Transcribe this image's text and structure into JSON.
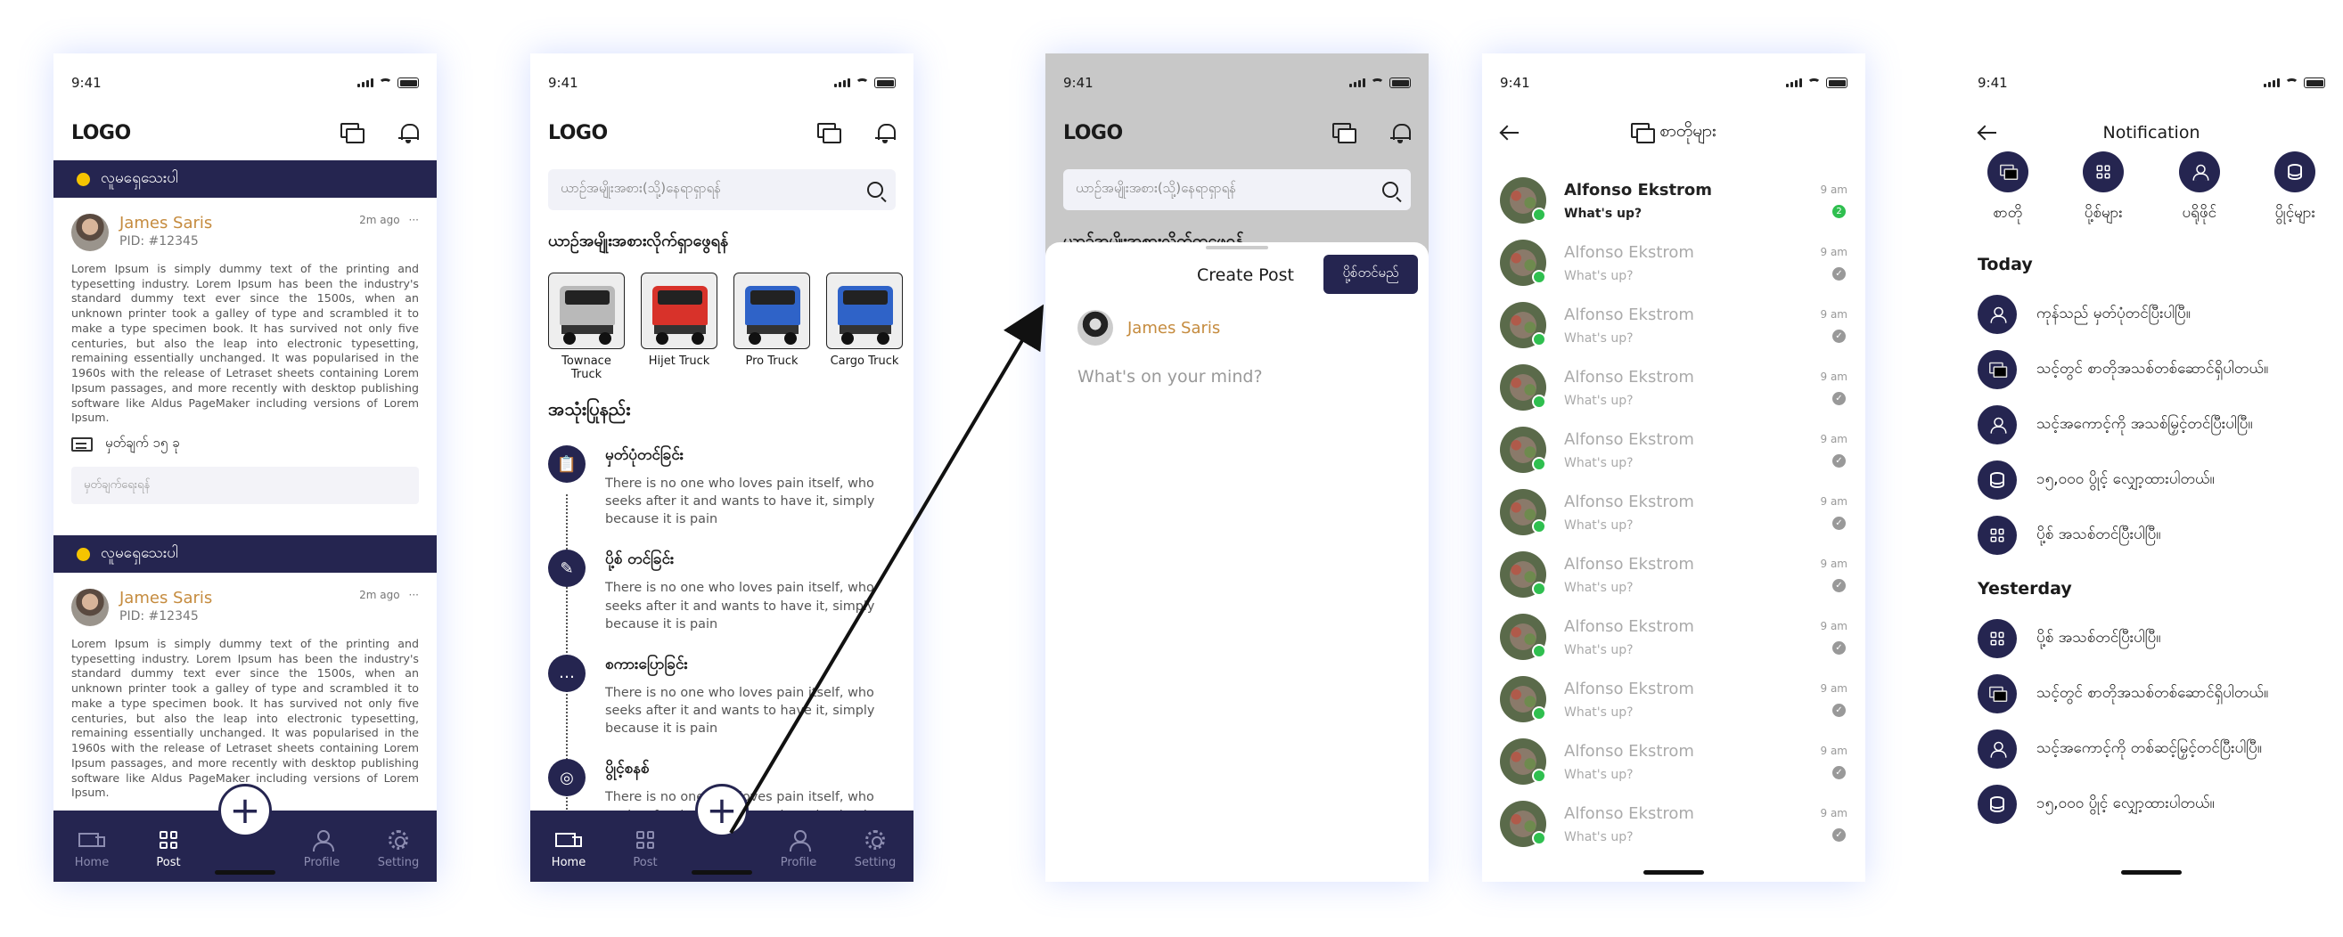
{
  "common": {
    "time": "9:41",
    "logo": "LOGO",
    "tabs": [
      "Home",
      "Post",
      "Profile",
      "Setting"
    ],
    "fab": "+"
  },
  "screen1": {
    "banner": "လူမရှေသေးပါ",
    "post": {
      "name": "James Saris",
      "pid": "PID: #12345",
      "time": "2m ago",
      "more": "···",
      "text": "Lorem Ipsum is simply dummy text of the printing and typesetting industry. Lorem Ipsum has been the industry's standard dummy text ever since the 1500s, when an unknown printer took a galley of type and scrambled it to make a type specimen book. It has survived not only five centuries, but also the leap into electronic typesetting, remaining essentially unchanged. It was popularised in the 1960s with the release of Letraset sheets containing Lorem Ipsum passages, and more recently with desktop publishing software like Aldus PageMaker including versions of Lorem Ipsum.",
      "comments": "မှတ်ချက် ၁၅ ခု",
      "comment_placeholder": "မှတ်ချက်ရေးရန်"
    },
    "post2": {
      "name": "James Saris",
      "pid": "PID: #12345",
      "time": "2m ago",
      "more": "···",
      "text": "Lorem Ipsum is simply dummy text of the printing and typesetting industry. Lorem Ipsum has been the industry's standard dummy text ever since the 1500s, when an unknown printer took a galley of type and scrambled it to make a type specimen book. It has survived not only five centuries, but also the leap into electronic typesetting, remaining essentially unchanged. It was popularised in the 1960s with the release of Letraset sheets containing Lorem Ipsum passages, and more recently with desktop publishing software like Aldus PageMaker including versions of Lorem Ipsum."
    }
  },
  "screen2": {
    "search_placeholder": "ယာဉ်အမျိုးအစား(သို့)နေရာရှာရန်",
    "trucks_title": "ယာဉ်အမျိုးအစားလိုက်ရှာဖွေရန်",
    "trucks": [
      {
        "label": "Townace Truck",
        "color": "#b9b9b9"
      },
      {
        "label": "Hijet Truck",
        "color": "#d8322a"
      },
      {
        "label": "Pro Truck",
        "color": "#2f63c8"
      },
      {
        "label": "Cargo Truck",
        "color": "#2f63c8"
      }
    ],
    "howto_title": "အသုံးပြုနည်း",
    "steps": [
      {
        "title": "မှတ်ပုံတင်ခြင်း",
        "icon": "clipboard-icon",
        "glyph": "📋",
        "desc": "There is no one who loves pain itself, who seeks after it and wants to have it, simply because it is pain"
      },
      {
        "title": "ပို့စ် တင်ခြင်း",
        "icon": "pencil-note-icon",
        "glyph": "✎",
        "desc": "There is no one who loves pain itself, who seeks after it and wants to have it, simply because it is pain"
      },
      {
        "title": "စကားပြောခြင်း",
        "icon": "chat-bubble-icon",
        "glyph": "…",
        "desc": "There is no one who loves pain itself, who seeks after it and wants to have it, simply because it is pain"
      },
      {
        "title": "ပွိုင့်စနစ်",
        "icon": "coin-icon",
        "glyph": "◎",
        "desc": "There is no one who loves pain itself, who seeks after it and wants to have it, simply"
      }
    ]
  },
  "screen3": {
    "search_placeholder": "ယာဉ်အမျိုးအစား(သို့)နေရာရှာရန်",
    "section_peek": "ယာဉ်အမျိုးအစားလိုက်ရှာဖွေရန်",
    "title": "Create Post",
    "post_button": "ပို့စ်တင်မည်",
    "user": "James Saris",
    "placeholder": "What's on your mind?"
  },
  "screen4": {
    "title": "စာတိုများ",
    "chats": [
      {
        "name": "Alfonso Ekstrom",
        "msg": "What's up?",
        "time": "9 am",
        "unread": true,
        "badge": "2"
      },
      {
        "name": "Alfonso Ekstrom",
        "msg": "What's up?",
        "time": "9 am",
        "unread": false
      },
      {
        "name": "Alfonso Ekstrom",
        "msg": "What's up?",
        "time": "9 am",
        "unread": false
      },
      {
        "name": "Alfonso Ekstrom",
        "msg": "What's up?",
        "time": "9 am",
        "unread": false
      },
      {
        "name": "Alfonso Ekstrom",
        "msg": "What's up?",
        "time": "9 am",
        "unread": false
      },
      {
        "name": "Alfonso Ekstrom",
        "msg": "What's up?",
        "time": "9 am",
        "unread": false
      },
      {
        "name": "Alfonso Ekstrom",
        "msg": "What's up?",
        "time": "9 am",
        "unread": false
      },
      {
        "name": "Alfonso Ekstrom",
        "msg": "What's up?",
        "time": "9 am",
        "unread": false
      },
      {
        "name": "Alfonso Ekstrom",
        "msg": "What's up?",
        "time": "9 am",
        "unread": false
      },
      {
        "name": "Alfonso Ekstrom",
        "msg": "What's up?",
        "time": "9 am",
        "unread": false
      },
      {
        "name": "Alfonso Ekstrom",
        "msg": "What's up?",
        "time": "9 am",
        "unread": false
      }
    ]
  },
  "screen5": {
    "title": "Notification",
    "categories": [
      {
        "label": "စာတို",
        "icon": "chat-icon"
      },
      {
        "label": "ပို့စ်များ",
        "icon": "grid-icon"
      },
      {
        "label": "ပရိုဖိုင်",
        "icon": "user-icon"
      },
      {
        "label": "ပွိုင့်များ",
        "icon": "database-icon"
      }
    ],
    "today_label": "Today",
    "today": [
      {
        "text": "ကုန်သည် မှတ်ပုံတင်ပြီးပါပြီ။",
        "icon": "user-icon"
      },
      {
        "text": "သင့်တွင် စာတိုအသစ်တစ်ဆောင်ရှိပါတယ်။",
        "icon": "chat-icon"
      },
      {
        "text": "သင့်အကောင့်ကို အသစ်မြှင့်တင်ပြီးပါပြီ။",
        "icon": "user-icon"
      },
      {
        "text": "၁၅,၀၀၀ ပွိုင့် လျှော့ထားပါတယ်။",
        "icon": "database-icon"
      },
      {
        "text": "ပို့စ် အသစ်တင်ပြီးပါပြီ။",
        "icon": "grid-icon"
      }
    ],
    "yesterday_label": "Yesterday",
    "yesterday": [
      {
        "text": "ပို့စ် အသစ်တင်ပြီးပါပြီ။",
        "icon": "grid-icon"
      },
      {
        "text": "သင့်တွင် စာတိုအသစ်တစ်ဆောင်ရှိပါတယ်။",
        "icon": "chat-icon"
      },
      {
        "text": "သင့်အကောင့်ကို တစ်ဆင့်မြှင့်တင်ပြီးပါပြီ။",
        "icon": "user-icon"
      },
      {
        "text": "၁၅,၀၀၀ ပွိုင့် လျှော့ထားပါတယ်။",
        "icon": "database-icon"
      }
    ]
  },
  "colors": {
    "primary": "#252550",
    "accent": "#c58b3e",
    "online": "#2fbf4f",
    "banner_dot": "#f5c400"
  }
}
